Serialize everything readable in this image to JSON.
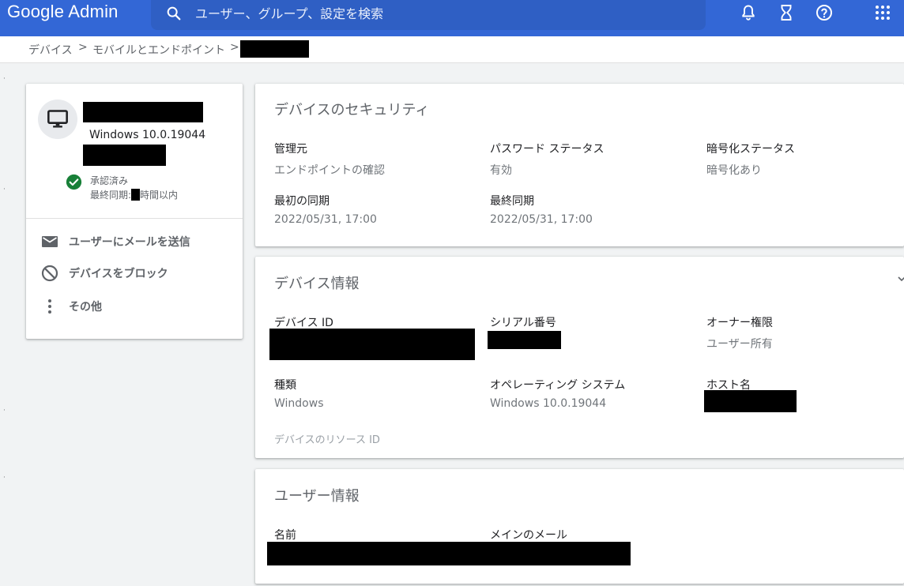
{
  "header": {
    "app_title": "Google Admin",
    "search_placeholder": "ユーザー、グループ、設定を検索",
    "icons": [
      "search-icon",
      "bell-icon",
      "hourglass-icon",
      "help-icon",
      "apps-grid-icon"
    ],
    "bg_color": "#3367d6"
  },
  "breadcrumb": {
    "items": [
      "デバイス",
      "モバイルとエンドポイント"
    ],
    "separator": ">"
  },
  "device_summary": {
    "icon": "desktop-icon",
    "os_version": "Windows 10.0.19044",
    "status": "承認済み",
    "last_sync_prefix": "最終同期:",
    "last_sync_suffix": "時間以内",
    "status_color": "#188038",
    "actions": [
      {
        "icon": "mail-icon",
        "label": "ユーザーにメールを送信"
      },
      {
        "icon": "block-icon",
        "label": "デバイスをブロック"
      },
      {
        "icon": "more-vert-icon",
        "label": "その他"
      }
    ]
  },
  "security": {
    "title": "デバイスのセキュリティ",
    "fields": [
      {
        "label": "管理元",
        "value": "エンドポイントの確認"
      },
      {
        "label": "パスワード ステータス",
        "value": "有効"
      },
      {
        "label": "暗号化ステータス",
        "value": "暗号化あり"
      },
      {
        "label": "最初の同期",
        "value": "2022/05/31, 17:00"
      },
      {
        "label": "最終同期",
        "value": "2022/05/31, 17:00"
      }
    ]
  },
  "device_info": {
    "title": "デバイス情報",
    "fields": [
      {
        "label": "デバイス ID",
        "value": ""
      },
      {
        "label": "シリアル番号",
        "value": ""
      },
      {
        "label": "オーナー権限",
        "value": "ユーザー所有"
      },
      {
        "label": "種類",
        "value": "Windows"
      },
      {
        "label": "オペレーティング システム",
        "value": "Windows 10.0.19044"
      },
      {
        "label": "ホスト名",
        "value": ""
      }
    ],
    "resource_id_label": "デバイスのリソース ID"
  },
  "user_info": {
    "title": "ユーザー情報",
    "fields": [
      {
        "label": "名前",
        "value": ""
      },
      {
        "label": "メインのメール",
        "value": ""
      }
    ]
  }
}
